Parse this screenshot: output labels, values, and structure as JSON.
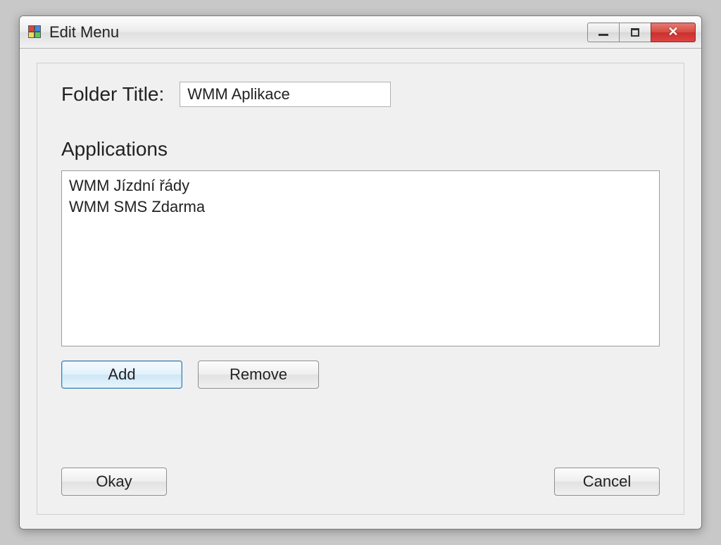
{
  "window": {
    "title": "Edit Menu"
  },
  "folder": {
    "label": "Folder Title:",
    "value": "WMM Aplikace"
  },
  "applications": {
    "heading": "Applications",
    "items": [
      "WMM Jízdní řády",
      "WMM SMS Zdarma"
    ]
  },
  "buttons": {
    "add": "Add",
    "remove": "Remove",
    "okay": "Okay",
    "cancel": "Cancel"
  }
}
